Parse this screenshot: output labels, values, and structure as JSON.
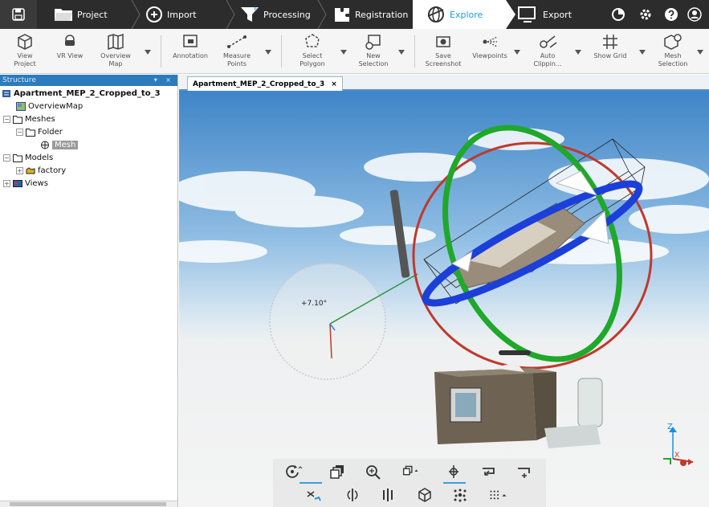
{
  "workflow": {
    "tabs": [
      {
        "label": "Project"
      },
      {
        "label": "Import"
      },
      {
        "label": "Processing"
      },
      {
        "label": "Registration"
      },
      {
        "label": "Explore"
      },
      {
        "label": "Export"
      }
    ],
    "active": "Explore"
  },
  "ribbon": {
    "view_project": "View\nProject",
    "vr_view": "VR View",
    "overview_map": "Overview\nMap",
    "annotation": "Annotation",
    "measure_points": "Measure\nPoints",
    "select_polygon": "Select\nPolygon",
    "new_selection": "New\nSelection",
    "save_screenshot": "Save\nScreenshot",
    "viewpoints": "Viewpoints",
    "auto_clipping": "Auto\nClippin...",
    "show_grid": "Show Grid",
    "mesh_selection": "Mesh\nSelection"
  },
  "structure": {
    "title": "Structure",
    "header_controls": "▾ ×",
    "root": "Apartment_MEP_2_Cropped_to_3",
    "items": [
      {
        "label": "OverviewMap"
      },
      {
        "label": "Meshes"
      },
      {
        "label": "Folder"
      },
      {
        "label": "Mesh"
      },
      {
        "label": "Models"
      },
      {
        "label": "factory"
      },
      {
        "label": "Views"
      }
    ]
  },
  "document": {
    "tab_label": "Apartment_MEP_2_Cropped_to_3",
    "close": "×"
  },
  "viewport": {
    "angle_readout": "+7.10°",
    "axis_z": "Z",
    "axis_x": "X"
  },
  "colors": {
    "accent": "#1a9fd8",
    "ring_red": "#c0392b",
    "ring_green": "#1fa82a",
    "ring_blue": "#1b3fd8",
    "topbar": "#2c2c2c"
  }
}
